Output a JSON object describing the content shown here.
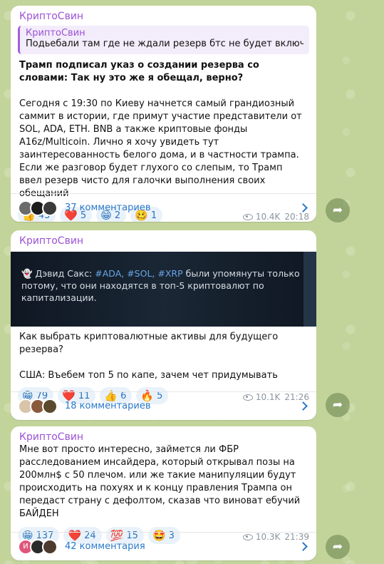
{
  "posts": [
    {
      "author": "КриптоСвин",
      "reply": {
        "name": "КриптоСвин",
        "text": "Подьебали там где не ждали   резерв бтс не будет включать ..."
      },
      "bold_text": "Трамп подписал указ о создании резерва со словами: Так ну это же я обещал, верно?",
      "text": "Сегодня с 19:30 по Киеву начнется самый грандиозный саммит в истории, где примут участие представители от SOL, ADA, ETH. BNB а также криптовые фонды A16z/Multicoin. Лично я хочу увидеть тут заинтересованность белого дома, и в частности трампа. Если же разговор будет глухого со слепым, то Трамп ввел резерв чисто для галочки выполнения своих обещаний",
      "reactions": [
        {
          "emoji": "👍",
          "count": "43"
        },
        {
          "emoji": "❤️",
          "count": "5"
        },
        {
          "emoji": "😁",
          "count": "2"
        },
        {
          "emoji": "🥴",
          "count": "1"
        }
      ],
      "views": "10.4K",
      "time": "20:18",
      "comments": "37 комментариев"
    },
    {
      "author": "КриптоСвин",
      "media": {
        "prefix": "Дэвид Сакс: ",
        "tags": "#ADA, #SOL, #XRP",
        "rest": " были упомянуты только потому, что они находятся в топ-5 криптовалют по капитализации."
      },
      "text": "Как выбрать криптовалютные активы для будущего резерва?\n\nСША: Въебем топ 5 по капе, зачем чет придумывать",
      "reactions": [
        {
          "emoji": "😁",
          "count": "79"
        },
        {
          "emoji": "❤️",
          "count": "11"
        },
        {
          "emoji": "👍",
          "count": "6"
        },
        {
          "emoji": "🔥",
          "count": "5"
        }
      ],
      "views": "10.1K",
      "time": "21:26",
      "comments": "18 комментариев"
    },
    {
      "author": "КриптоСвин",
      "text": "Мне вот просто интересно, займется ли ФБР расследованием инсайдера, который открывал позы на 200млн$ с 50 плечом. или же такие манипуляции будут происходить на похуях и к концу правления Трампа он передаст страну с дефолтом, сказав что виноват ебучий БАЙДЕН",
      "reactions": [
        {
          "emoji": "😁",
          "count": "137"
        },
        {
          "emoji": "❤️",
          "count": "24"
        },
        {
          "emoji": "💯",
          "count": "15"
        },
        {
          "emoji": "🤩",
          "count": "3"
        }
      ],
      "views": "10.3K",
      "time": "21:39",
      "comments": "42 комментария"
    }
  ],
  "avatar_letter": "И"
}
